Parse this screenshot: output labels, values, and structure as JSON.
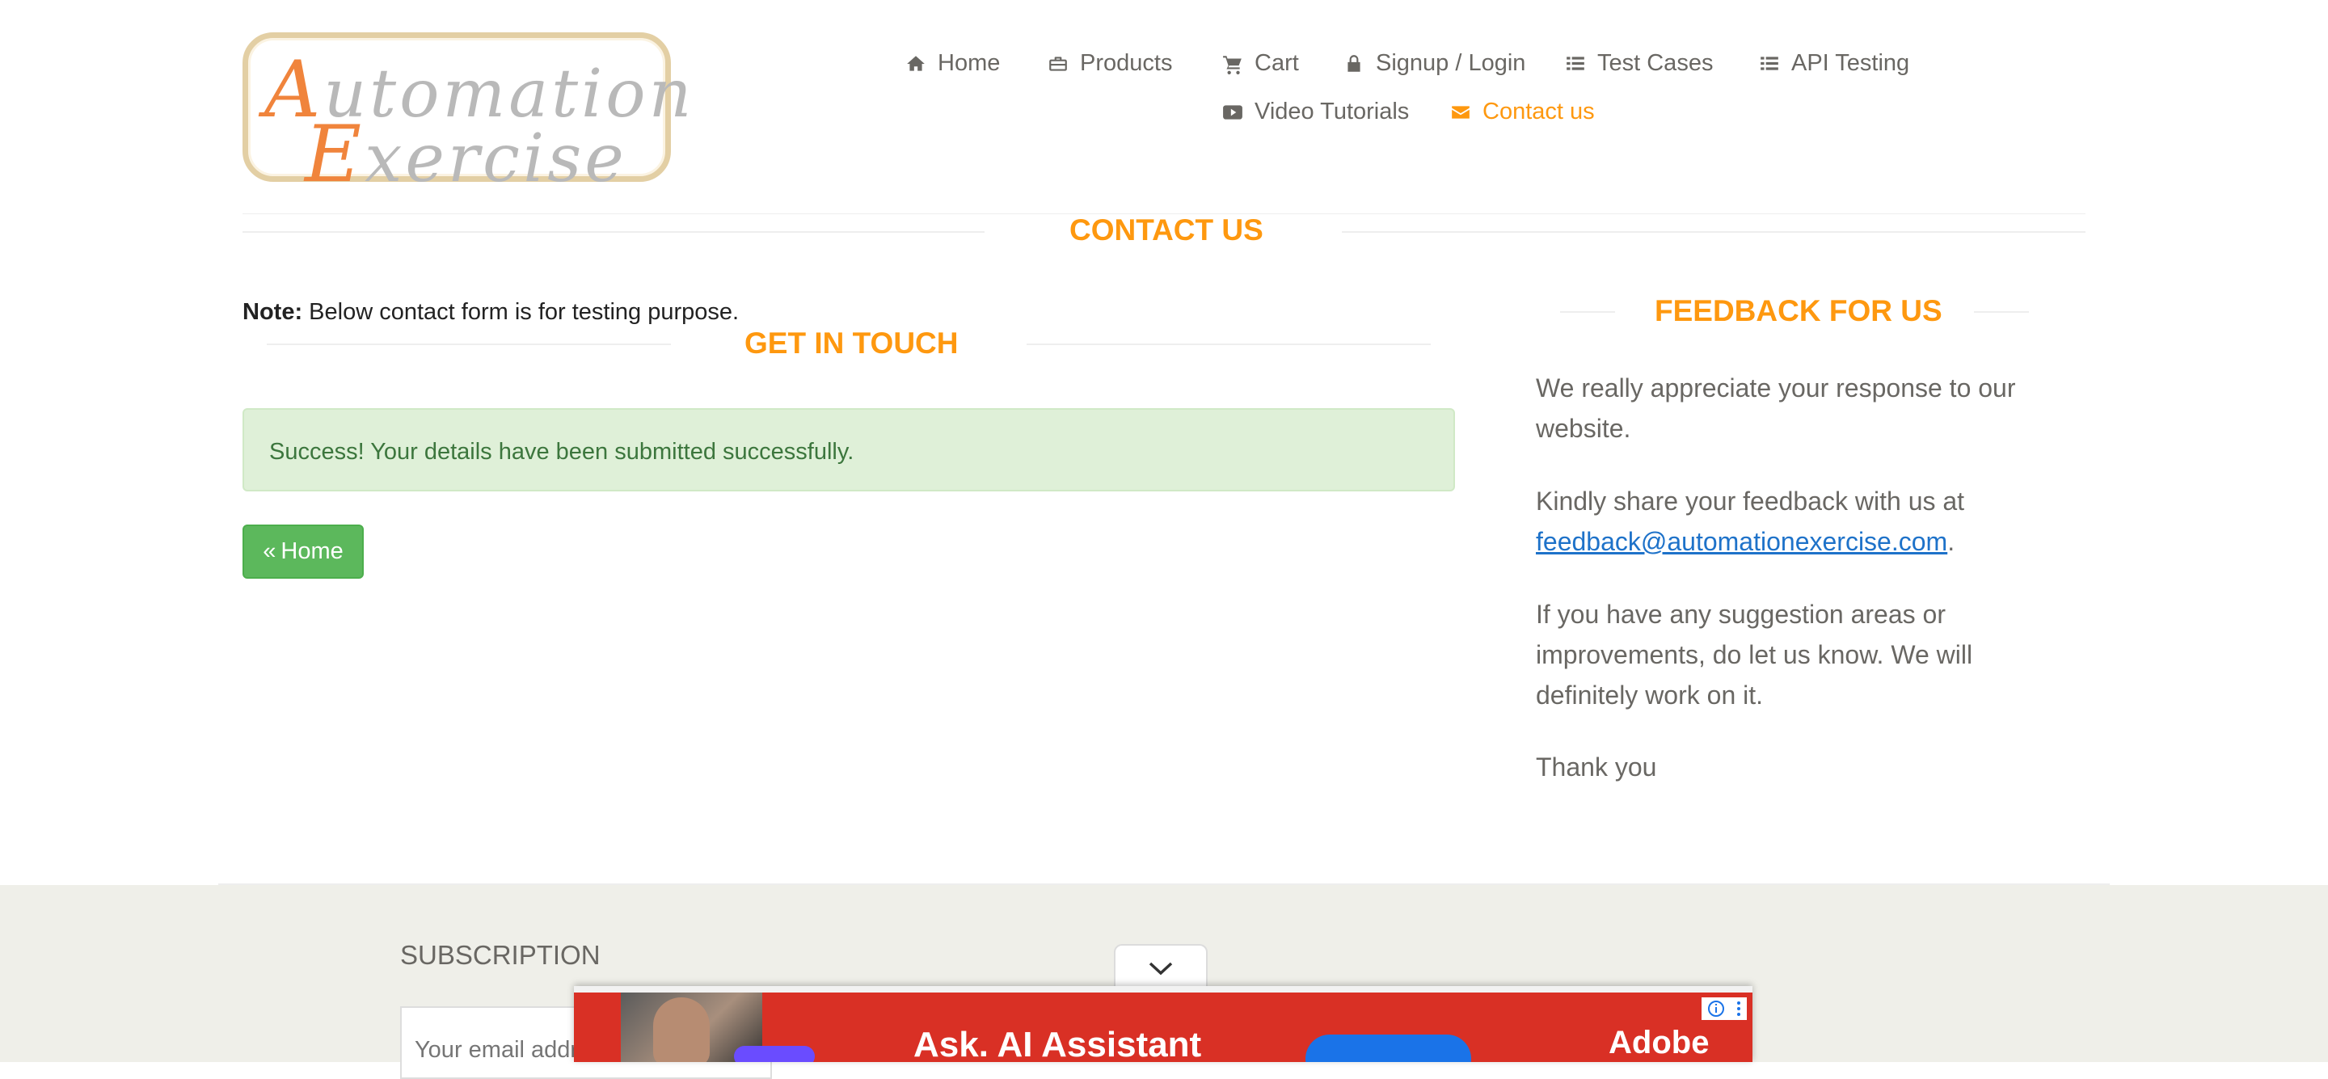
{
  "logo": {
    "line1_cap": "A",
    "line1_rest": "utomation",
    "line2_cap": "E",
    "line2_rest": "xercise"
  },
  "nav": {
    "home": "Home",
    "products": "Products",
    "cart": "Cart",
    "signup_login": "Signup / Login",
    "test_cases": "Test Cases",
    "api_testing": "API Testing",
    "video_tutorials": "Video Tutorials",
    "contact_us": "Contact us",
    "active": "contact_us"
  },
  "page_title": "Contact Us",
  "note": {
    "label": "Note:",
    "text": " Below contact form is for testing purpose."
  },
  "get_in_touch": "Get In Touch",
  "success_message": "Success! Your details have been submitted successfully.",
  "home_button": {
    "icon": "«",
    "label": "Home"
  },
  "feedback": {
    "title": "Feedback For Us",
    "para1": "We really appreciate your response to our website.",
    "para2_prefix": "Kindly share your feedback with us at ",
    "email": "feedback@automationexercise.com",
    "para2_suffix": ".",
    "para3": "If you have any suggestion areas or improvements, do let us know. We will definitely work on it.",
    "para4": "Thank you"
  },
  "footer": {
    "subscription_title": "SUBSCRIPTION",
    "email_placeholder": "Your email address"
  },
  "ad": {
    "headline": "Ask. AI Assistant",
    "brand": "Adobe"
  },
  "colors": {
    "accent": "#fe980f",
    "success_bg": "#dff0d8",
    "success_text": "#3c763d",
    "button_green": "#5cb85c",
    "link": "#1e72c9",
    "footer_bg": "#efefe9",
    "ad_bg": "#d93025"
  }
}
